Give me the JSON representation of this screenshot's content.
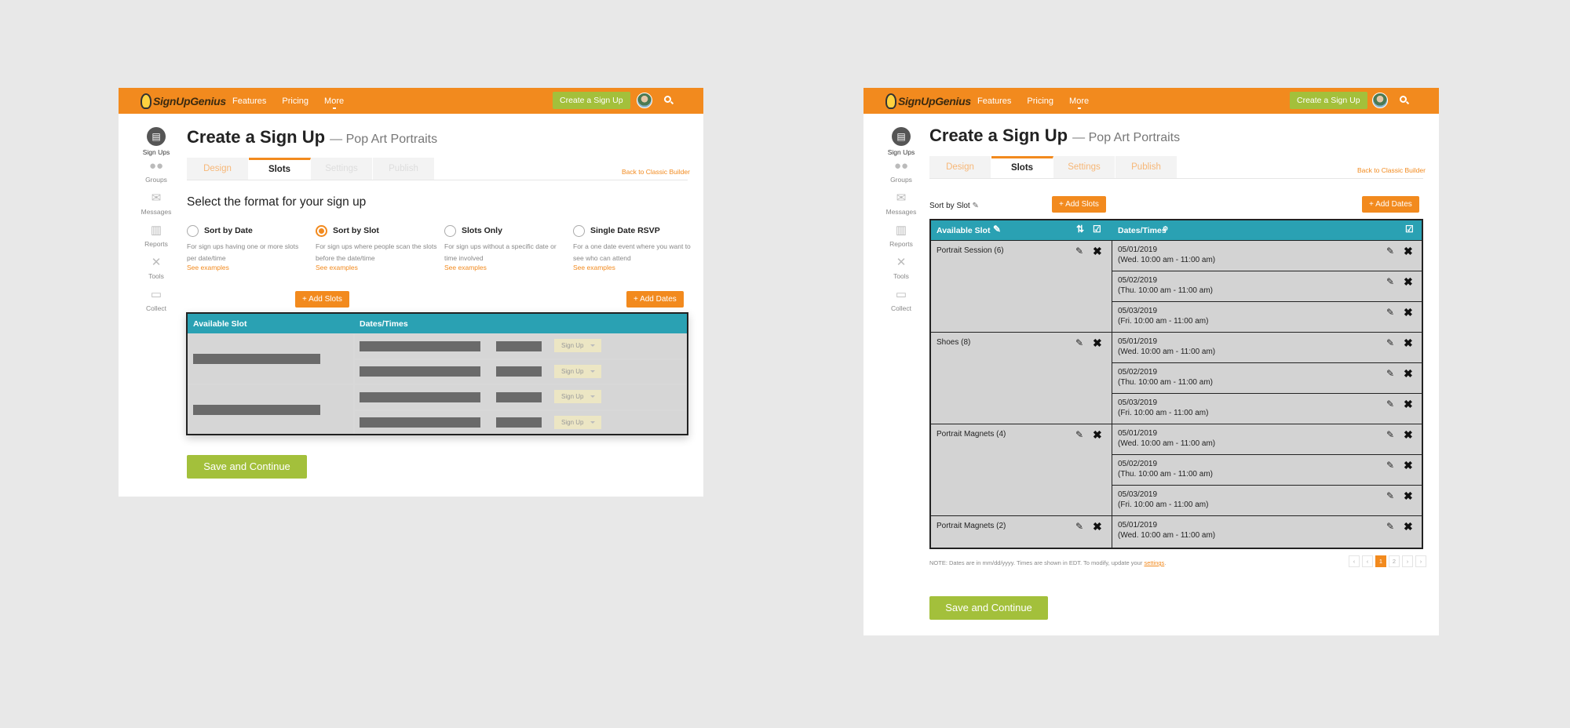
{
  "brand": {
    "logo_text": "SignUpGenius",
    "accent": "#f28a1e",
    "green": "#a3c03b",
    "teal": "#2aa1b3"
  },
  "nav": {
    "features": "Features",
    "pricing": "Pricing",
    "more": "More",
    "create": "Create a Sign Up"
  },
  "sidebar": [
    {
      "label": "Sign Ups",
      "icon": "clipboard-icon"
    },
    {
      "label": "Groups",
      "icon": "people-icon"
    },
    {
      "label": "Messages",
      "icon": "envelope-icon"
    },
    {
      "label": "Reports",
      "icon": "bar-chart-icon"
    },
    {
      "label": "Tools",
      "icon": "tools-icon"
    },
    {
      "label": "Collect",
      "icon": "money-icon"
    }
  ],
  "page": {
    "title": "Create a Sign Up",
    "subtitle": "— Pop Art Portraits",
    "classic": "Back to Classic Builder",
    "save": "Save and Continue"
  },
  "tabs": [
    "Design",
    "Slots",
    "Settings",
    "Publish"
  ],
  "left": {
    "heading": "Select the format for your sign up",
    "options": [
      {
        "label": "Sort by Date",
        "desc": "For sign ups having one or more slots per date/time",
        "link": "See examples",
        "selected": false
      },
      {
        "label": "Sort by Slot",
        "desc": "For sign ups where people scan the slots before the date/time",
        "link": "See examples",
        "selected": true
      },
      {
        "label": "Slots Only",
        "desc": "For sign ups without a specific date or time involved",
        "link": "See examples",
        "selected": false
      },
      {
        "label": "Single Date RSVP",
        "desc": "For a one date event where you want to see who can attend",
        "link": "See examples",
        "selected": false
      }
    ],
    "add_slots": "+ Add Slots",
    "add_dates": "+ Add Dates",
    "col_slot": "Available Slot",
    "col_dates": "Dates/Times",
    "signup_label": "Sign Up"
  },
  "right": {
    "sort_label": "Sort by Slot",
    "add_slots": "+ Add Slots",
    "add_dates": "+ Add Dates",
    "col_slot": "Available Slot",
    "col_dates": "Dates/Times",
    "slots": [
      {
        "name": "Portrait Session (6)",
        "dates": [
          [
            "05/01/2019",
            "(Wed. 10:00 am - 11:00 am)"
          ],
          [
            "05/02/2019",
            "(Thu. 10:00 am - 11:00 am)"
          ],
          [
            "05/03/2019",
            "(Fri. 10:00 am - 11:00 am)"
          ]
        ]
      },
      {
        "name": "Shoes (8)",
        "dates": [
          [
            "05/01/2019",
            "(Wed. 10:00 am - 11:00 am)"
          ],
          [
            "05/02/2019",
            "(Thu. 10:00 am - 11:00 am)"
          ],
          [
            "05/03/2019",
            "(Fri. 10:00 am - 11:00 am)"
          ]
        ]
      },
      {
        "name": "Portrait Magnets (4)",
        "dates": [
          [
            "05/01/2019",
            "(Wed. 10:00 am - 11:00 am)"
          ],
          [
            "05/02/2019",
            "(Thu. 10:00 am - 11:00 am)"
          ],
          [
            "05/03/2019",
            "(Fri. 10:00 am - 11:00 am)"
          ]
        ]
      },
      {
        "name": "Portrait Magnets (2)",
        "dates": [
          [
            "05/01/2019",
            "(Wed. 10:00 am - 11:00 am)"
          ]
        ]
      }
    ],
    "note": "NOTE: Dates are in mm/dd/yyyy. Times are shown in EDT. To modify, update your",
    "note_link": "settings",
    "pages": [
      "‹",
      "‹",
      "1",
      "2",
      "›",
      "›"
    ],
    "current_page": "1"
  }
}
